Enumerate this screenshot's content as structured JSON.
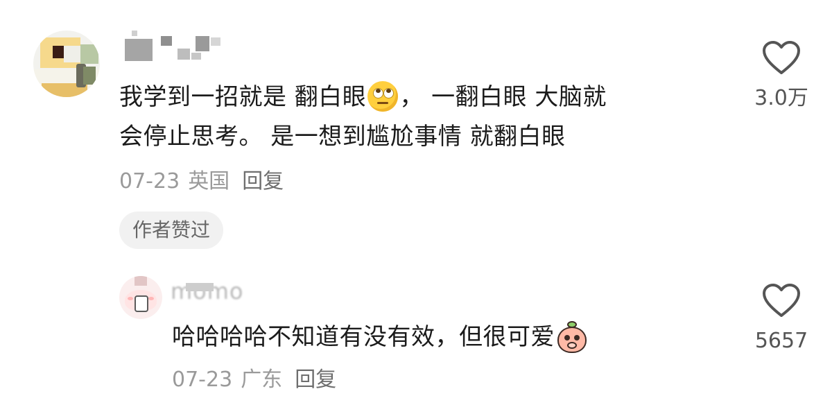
{
  "comments": [
    {
      "author_label": "",
      "text_before_emoji": "我学到一招就是 翻白眼",
      "emoji": "eye-roll-emoji",
      "text_after_emoji_line1": "，  一翻白眼 大脑就",
      "text_line2": "会停止思考。 是一想到尴尬事情 就翻白眼",
      "date": "07-23",
      "location": "英国",
      "reply_label": "回复",
      "badge": "作者赞过",
      "likes": "3.0万"
    },
    {
      "author_label": "momo",
      "text": "哈哈哈哈不知道有没有效，但很可爱",
      "emoji": "peach-blush-emoji",
      "date": "07-23",
      "location": "广东",
      "reply_label": "回复",
      "likes": "5657"
    }
  ],
  "colors": {
    "text": "#1b1b1b",
    "meta": "#9a9a9a",
    "badge_bg": "#f1f1f1",
    "like_icon": "#555555"
  }
}
